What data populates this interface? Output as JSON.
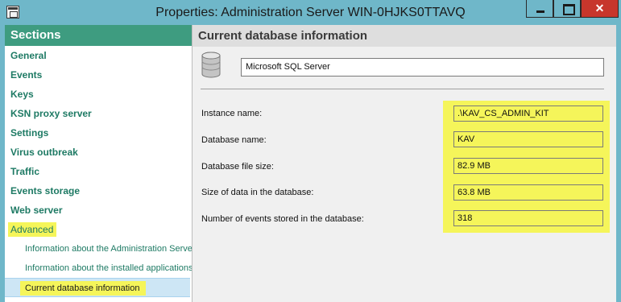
{
  "window": {
    "title": "Properties: Administration Server WIN-0HJKS0TTAVQ",
    "close_glyph": "✕"
  },
  "sidebar": {
    "header": "Sections",
    "items": [
      {
        "label": "General"
      },
      {
        "label": "Events"
      },
      {
        "label": "Keys"
      },
      {
        "label": "KSN proxy server"
      },
      {
        "label": "Settings"
      },
      {
        "label": "Virus outbreak"
      },
      {
        "label": "Traffic"
      },
      {
        "label": "Events storage"
      },
      {
        "label": "Web server"
      }
    ],
    "advanced": {
      "label": "Advanced",
      "children": [
        {
          "label": "Information about the Administration Server"
        },
        {
          "label": "Information about the installed applications"
        },
        {
          "label": "Current database information",
          "selected": true
        }
      ]
    }
  },
  "main": {
    "header": "Current database information",
    "db_icon": "database-icon",
    "db_type": "Microsoft SQL Server",
    "fields": [
      {
        "label": "Instance name:",
        "value": ".\\KAV_CS_ADMIN_KIT"
      },
      {
        "label": "Database name:",
        "value": "KAV"
      },
      {
        "label": "Database file size:",
        "value": "82.9 MB"
      },
      {
        "label": "Size of data in the database:",
        "value": "63.8 MB"
      },
      {
        "label": "Number of events stored in the database:",
        "value": "318"
      }
    ]
  },
  "colors": {
    "titlebar": "#6fb7c9",
    "sections_header": "#3e9c80",
    "nav_text": "#1e7a64",
    "highlight": "#f5f55a",
    "selected_row": "#cde6f5",
    "close_button": "#c7362c"
  }
}
